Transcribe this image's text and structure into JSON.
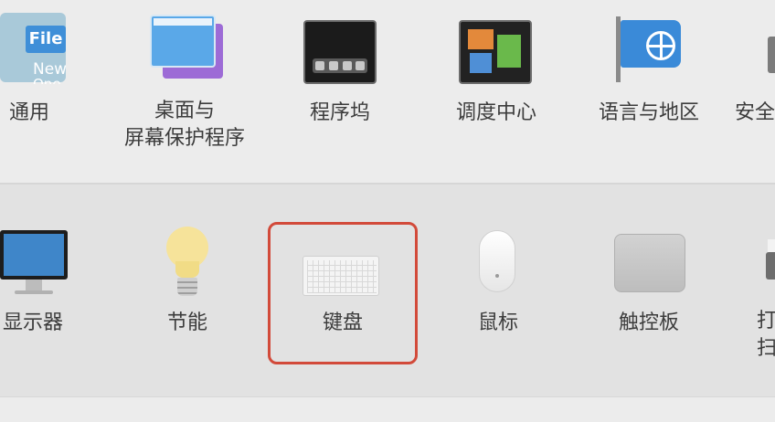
{
  "row1": {
    "general": {
      "label": "通用",
      "icon_text_1": "File",
      "icon_text_2": "New",
      "icon_text_3": "One"
    },
    "desktop": {
      "label_line1": "桌面与",
      "label_line2": "屏幕保护程序"
    },
    "dock": {
      "label": "程序坞"
    },
    "mission_control": {
      "label": "调度中心"
    },
    "language": {
      "label": "语言与地区"
    },
    "security": {
      "label": "安全"
    }
  },
  "row2": {
    "displays": {
      "label": "显示器"
    },
    "energy": {
      "label": "节能"
    },
    "keyboard": {
      "label": "键盘"
    },
    "mouse": {
      "label": "鼠标"
    },
    "trackpad": {
      "label": "触控板"
    },
    "printers": {
      "label_line1": "打",
      "label_line2": "扫"
    }
  },
  "colors": {
    "highlight": "#d24a3a",
    "accent_blue": "#3f8fd8"
  },
  "icons": {
    "general": "general-file-icon",
    "desktop": "desktop-screensaver-icon",
    "dock": "dock-icon",
    "mission_control": "mission-control-icon",
    "language": "language-flag-icon",
    "security": "security-lock-icon",
    "displays": "display-icon",
    "energy": "lightbulb-icon",
    "keyboard": "keyboard-icon",
    "mouse": "mouse-icon",
    "trackpad": "trackpad-icon",
    "printers": "printer-icon"
  }
}
